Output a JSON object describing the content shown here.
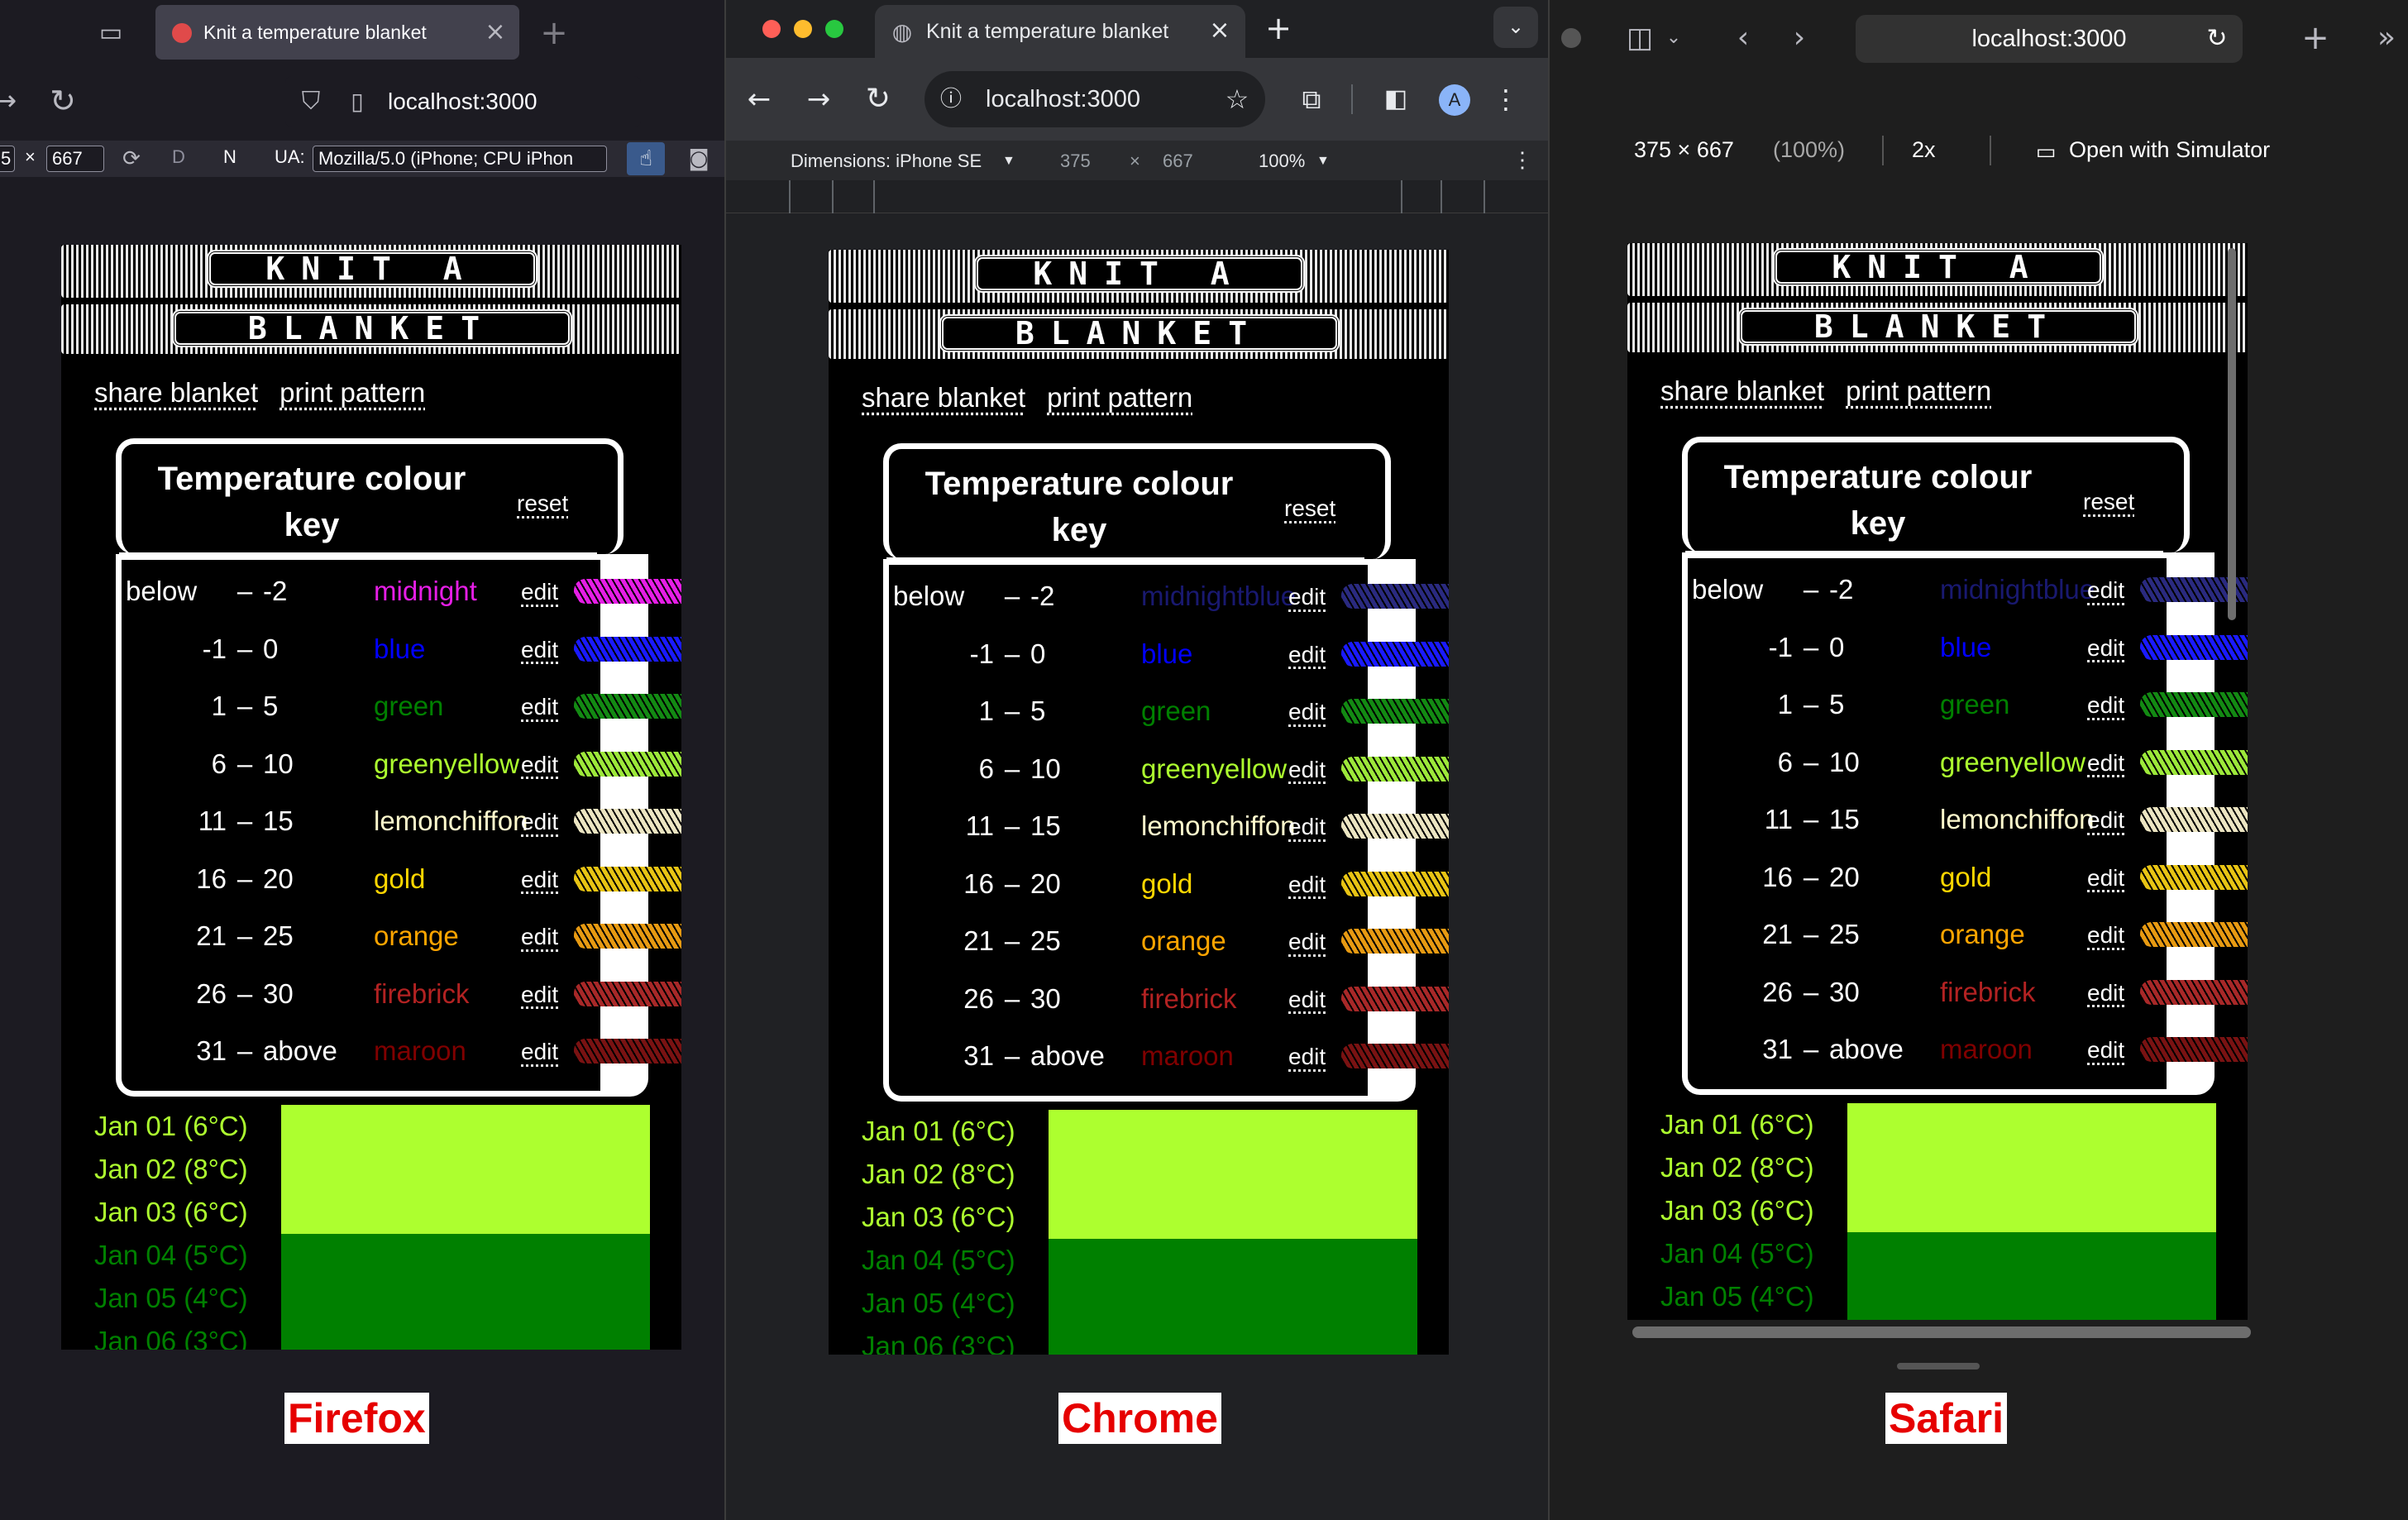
{
  "tab_title": "Knit a temperature blanket",
  "url": "localhost:3000",
  "firefox": {
    "rdm_height": "667",
    "rdm_width_partial": "5",
    "rdm_times": "×",
    "rdm_d": "D",
    "rdm_n": "N",
    "ua_label": "UA:",
    "ua_value": "Mozilla/5.0 (iPhone; CPU iPhon"
  },
  "chrome": {
    "dimensions_label": "Dimensions: iPhone SE",
    "width": "375",
    "times": "×",
    "height": "667",
    "zoom": "100%",
    "avatar": "A"
  },
  "safari": {
    "dims": "375 × 667",
    "percent": "(100%)",
    "scale": "2x",
    "simulator": "Open with Simulator"
  },
  "page": {
    "header_line1": "KNIT A",
    "header_line2": "BLANKET",
    "share": "share blanket",
    "print": "print pattern",
    "key_title": "Temperature colour key",
    "reset": "reset",
    "edit": "edit",
    "dash": "–",
    "rows": [
      {
        "lo": "below",
        "hi": "-2",
        "color_ff": "midnight",
        "color": "midnightblue",
        "css_ff": "#e61ee6",
        "css": "#191970",
        "yarn_ff": "#e61ee6",
        "yarn": "#2a2a80"
      },
      {
        "lo": "-1",
        "hi": "0",
        "color_ff": "blue",
        "color": "blue",
        "css_ff": "#0000ff",
        "css": "#0000ff",
        "yarn_ff": "#1a1aff",
        "yarn": "#1a1aff"
      },
      {
        "lo": "1",
        "hi": "5",
        "color_ff": "green",
        "color": "green",
        "css_ff": "#008000",
        "css": "#008000",
        "yarn_ff": "#138a13",
        "yarn": "#138a13"
      },
      {
        "lo": "6",
        "hi": "10",
        "color_ff": "greenyellow",
        "color": "greenyellow",
        "css_ff": "#adff2f",
        "css": "#adff2f",
        "yarn_ff": "#9de83a",
        "yarn": "#9de83a"
      },
      {
        "lo": "11",
        "hi": "15",
        "color_ff": "lemonchiffon",
        "color": "lemonchiffon",
        "css_ff": "#fffacd",
        "css": "#fffacd",
        "yarn_ff": "#ece5c2",
        "yarn": "#ece5c2"
      },
      {
        "lo": "16",
        "hi": "20",
        "color_ff": "gold",
        "color": "gold",
        "css_ff": "#ffd700",
        "css": "#ffd700",
        "yarn_ff": "#e8c414",
        "yarn": "#e8c414"
      },
      {
        "lo": "21",
        "hi": "25",
        "color_ff": "orange",
        "color": "orange",
        "css_ff": "#ffa500",
        "css": "#ffa500",
        "yarn_ff": "#e79a12",
        "yarn": "#e79a12"
      },
      {
        "lo": "26",
        "hi": "30",
        "color_ff": "firebrick",
        "color": "firebrick",
        "css_ff": "#b22222",
        "css": "#b22222",
        "yarn_ff": "#a82828",
        "yarn": "#a82828"
      },
      {
        "lo": "31",
        "hi": "above",
        "color_ff": "maroon",
        "color": "maroon",
        "css_ff": "#800000",
        "css": "#800000",
        "yarn_ff": "#7a1212",
        "yarn": "#7a1212"
      }
    ],
    "days": [
      {
        "label": "Jan 01 (6°C)",
        "color": "#adff2f"
      },
      {
        "label": "Jan 02 (8°C)",
        "color": "#adff2f"
      },
      {
        "label": "Jan 03 (6°C)",
        "color": "#adff2f"
      },
      {
        "label": "Jan 04 (5°C)",
        "color": "#008000"
      },
      {
        "label": "Jan 05 (4°C)",
        "color": "#008000"
      },
      {
        "label": "Jan 06 (3°C)",
        "color": "#008000"
      }
    ],
    "swatch_top": "#adff2f",
    "swatch_bottom": "#008000"
  },
  "labels": {
    "firefox": "Firefox",
    "chrome": "Chrome",
    "safari": "Safari"
  }
}
